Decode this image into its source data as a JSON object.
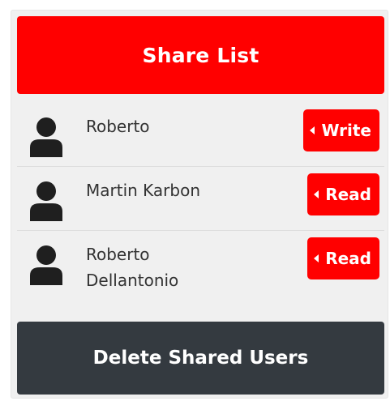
{
  "header": {
    "title": "Share List"
  },
  "users": [
    {
      "name": "Roberto",
      "permission": "Write",
      "icon": "user-icon"
    },
    {
      "name": "Martin Karbon",
      "permission": "Read",
      "icon": "user-icon"
    },
    {
      "name": "Roberto Dellantonio",
      "permission": "Read",
      "icon": "user-icon"
    }
  ],
  "footer": {
    "delete_label": "Delete Shared Users"
  },
  "colors": {
    "accent": "#ff0000",
    "dark": "#343a40",
    "panel": "#f0f0f0",
    "text": "#333333",
    "avatar": "#1f1f1f"
  }
}
